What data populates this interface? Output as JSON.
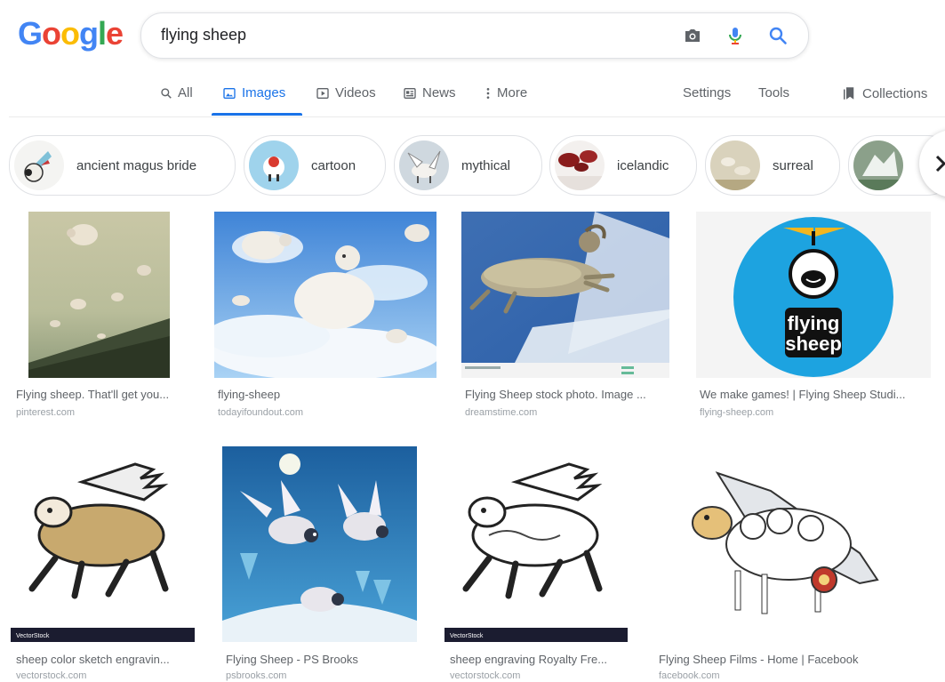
{
  "logo": {
    "letters": [
      "G",
      "o",
      "o",
      "g",
      "l",
      "e"
    ],
    "colors": [
      "#4285f4",
      "#ea4335",
      "#fbbc05",
      "#4285f4",
      "#34a853",
      "#ea4335"
    ]
  },
  "search": {
    "query": "flying sheep"
  },
  "icons": {
    "camera": "camera-icon",
    "mic": "microphone-icon",
    "search": "search-icon"
  },
  "nav": {
    "tabs": [
      {
        "label": "All",
        "icon": "search-icon"
      },
      {
        "label": "Images",
        "icon": "image-icon",
        "active": true
      },
      {
        "label": "Videos",
        "icon": "video-icon"
      },
      {
        "label": "News",
        "icon": "news-icon"
      },
      {
        "label": "More",
        "icon": "more-icon"
      }
    ],
    "settings": "Settings",
    "tools": "Tools",
    "collections": "Collections"
  },
  "chips": [
    "ancient magus bride",
    "cartoon",
    "mythical",
    "icelandic",
    "surreal"
  ],
  "results": [
    {
      "caption": "Flying sheep. That'll get you...",
      "source": "pinterest.com"
    },
    {
      "caption": "flying-sheep",
      "source": "todayifoundout.com"
    },
    {
      "caption": "Flying Sheep stock photo. Image ...",
      "source": "dreamstime.com"
    },
    {
      "caption": "We make games! | Flying Sheep Studi...",
      "source": "flying-sheep.com"
    },
    {
      "caption": "sheep color sketch engravin...",
      "source": "vectorstock.com"
    },
    {
      "caption": "Flying Sheep - PS Brooks",
      "source": "psbrooks.com"
    },
    {
      "caption": "sheep engraving Royalty Fre...",
      "source": "vectorstock.com"
    },
    {
      "caption": "Flying Sheep Films - Home | Facebook",
      "source": "facebook.com"
    }
  ],
  "logo_text": {
    "line1": "flying",
    "line2": "sheep"
  },
  "stock_label": "VectorStock",
  "colors": {
    "accent": "#1a73e8",
    "link": "#5f6368"
  }
}
